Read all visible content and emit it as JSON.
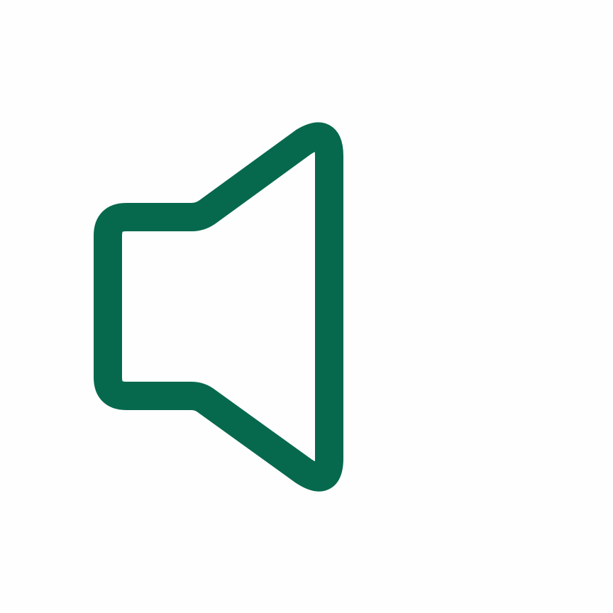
{
  "icon": {
    "name": "speaker-icon",
    "stroke_color": "#06694d",
    "background_color": "#fefefe"
  }
}
